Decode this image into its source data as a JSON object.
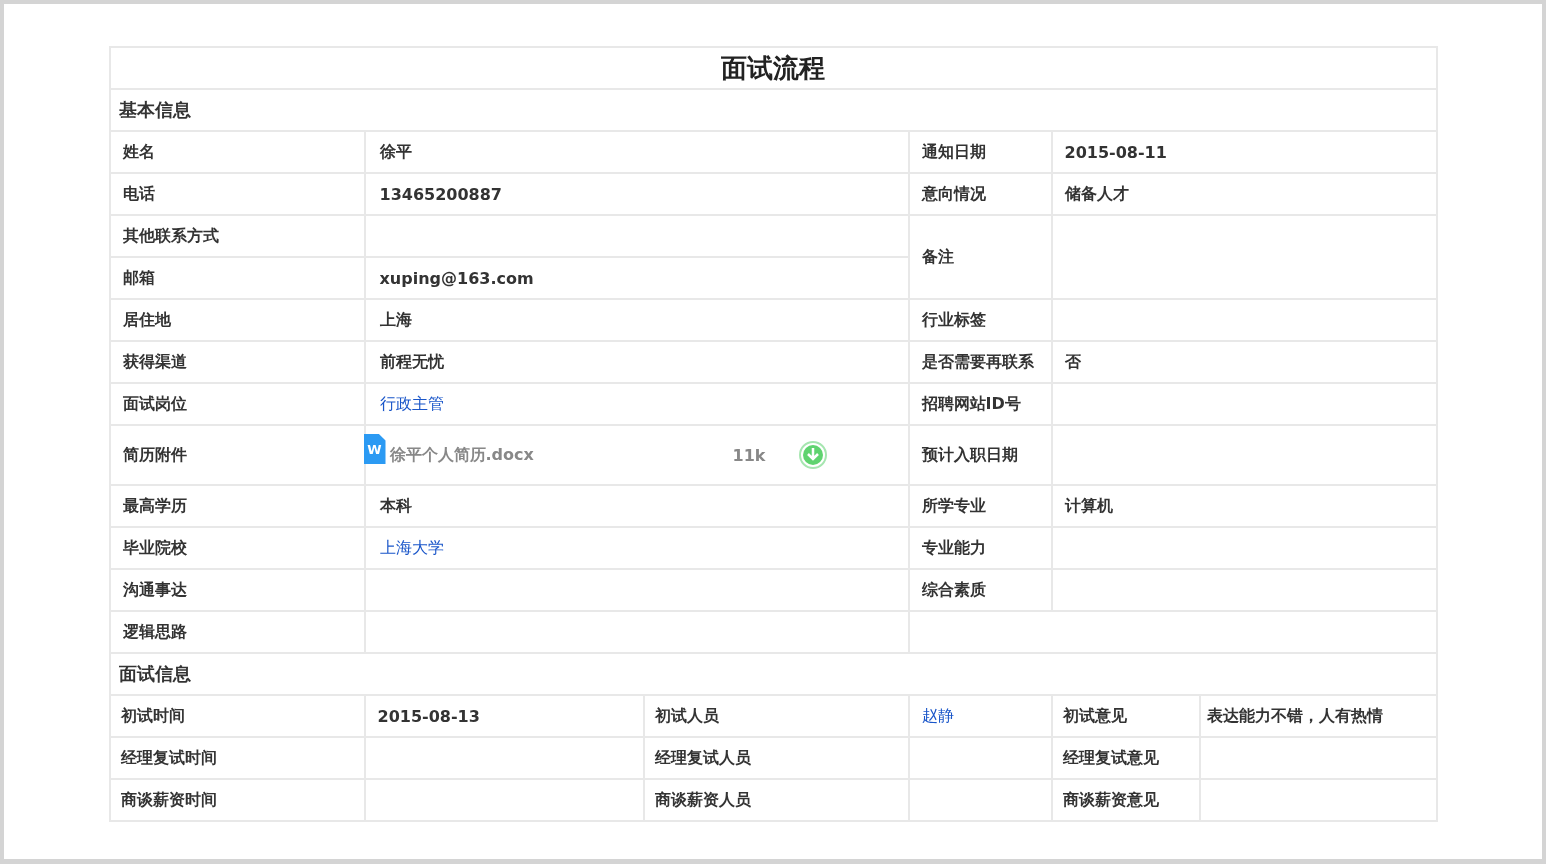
{
  "title": "面试流程",
  "basic_info": {
    "heading": "基本信息",
    "left": [
      {
        "label": "姓名",
        "kind": "text",
        "value": "徐平"
      },
      {
        "label": "电话",
        "kind": "text",
        "value": "13465200887"
      },
      {
        "label": "其他联系方式",
        "kind": "text"
      },
      {
        "label": "邮箱",
        "kind": "text",
        "value": "xuping@163.com"
      },
      {
        "label": "居住地",
        "kind": "text",
        "value": "上海"
      },
      {
        "label": "获得渠道",
        "kind": "text",
        "value": "前程无忧"
      },
      {
        "label": "面试岗位",
        "kind": "link",
        "value": "行政主管"
      },
      {
        "label": "简历附件",
        "kind": "file",
        "file": {
          "icon_text": "W",
          "name": "徐平个人简历.docx",
          "size": "11k"
        }
      },
      {
        "label": "最高学历",
        "kind": "text",
        "value": "本科"
      },
      {
        "label": "毕业院校",
        "kind": "link",
        "value": "上海大学"
      },
      {
        "label": "沟通事达",
        "kind": "text"
      },
      {
        "label": "逻辑思路",
        "kind": "text"
      }
    ],
    "right": [
      {
        "label": "通知日期",
        "kind": "text",
        "value": "2015-08-11"
      },
      {
        "label": "意向情况",
        "kind": "text",
        "value": "储备人才"
      },
      {
        "label": "备注",
        "kind": "double"
      },
      {
        "label": "行业标签",
        "kind": "text"
      },
      {
        "label": "是否需要再联系",
        "kind": "text",
        "value": "否"
      },
      {
        "label": "招聘网站ID号",
        "kind": "text"
      },
      {
        "label": "预计入职日期",
        "kind": "text"
      },
      {
        "label": "所学专业",
        "kind": "text",
        "value": "计算机"
      },
      {
        "label": "专业能力",
        "kind": "text"
      },
      {
        "label": "综合素质",
        "kind": "text"
      }
    ]
  },
  "interview_info": {
    "heading": "面试信息",
    "rows": [
      [
        {
          "label": "初试时间",
          "kind": "text",
          "value": "2015-08-13"
        },
        {
          "label": "初试人员",
          "kind": "link",
          "value": "赵静"
        },
        {
          "label": "初试意见",
          "kind": "text",
          "value": "表达能力不错，人有热情"
        }
      ],
      [
        {
          "label": "经理复试时间",
          "kind": "text"
        },
        {
          "label": "经理复试人员",
          "kind": "text"
        },
        {
          "label": "经理复试意见",
          "kind": "text"
        }
      ],
      [
        {
          "label": "商谈薪资时间",
          "kind": "text"
        },
        {
          "label": "商谈薪资人员",
          "kind": "text"
        },
        {
          "label": "商谈薪资意见",
          "kind": "text"
        }
      ]
    ]
  }
}
